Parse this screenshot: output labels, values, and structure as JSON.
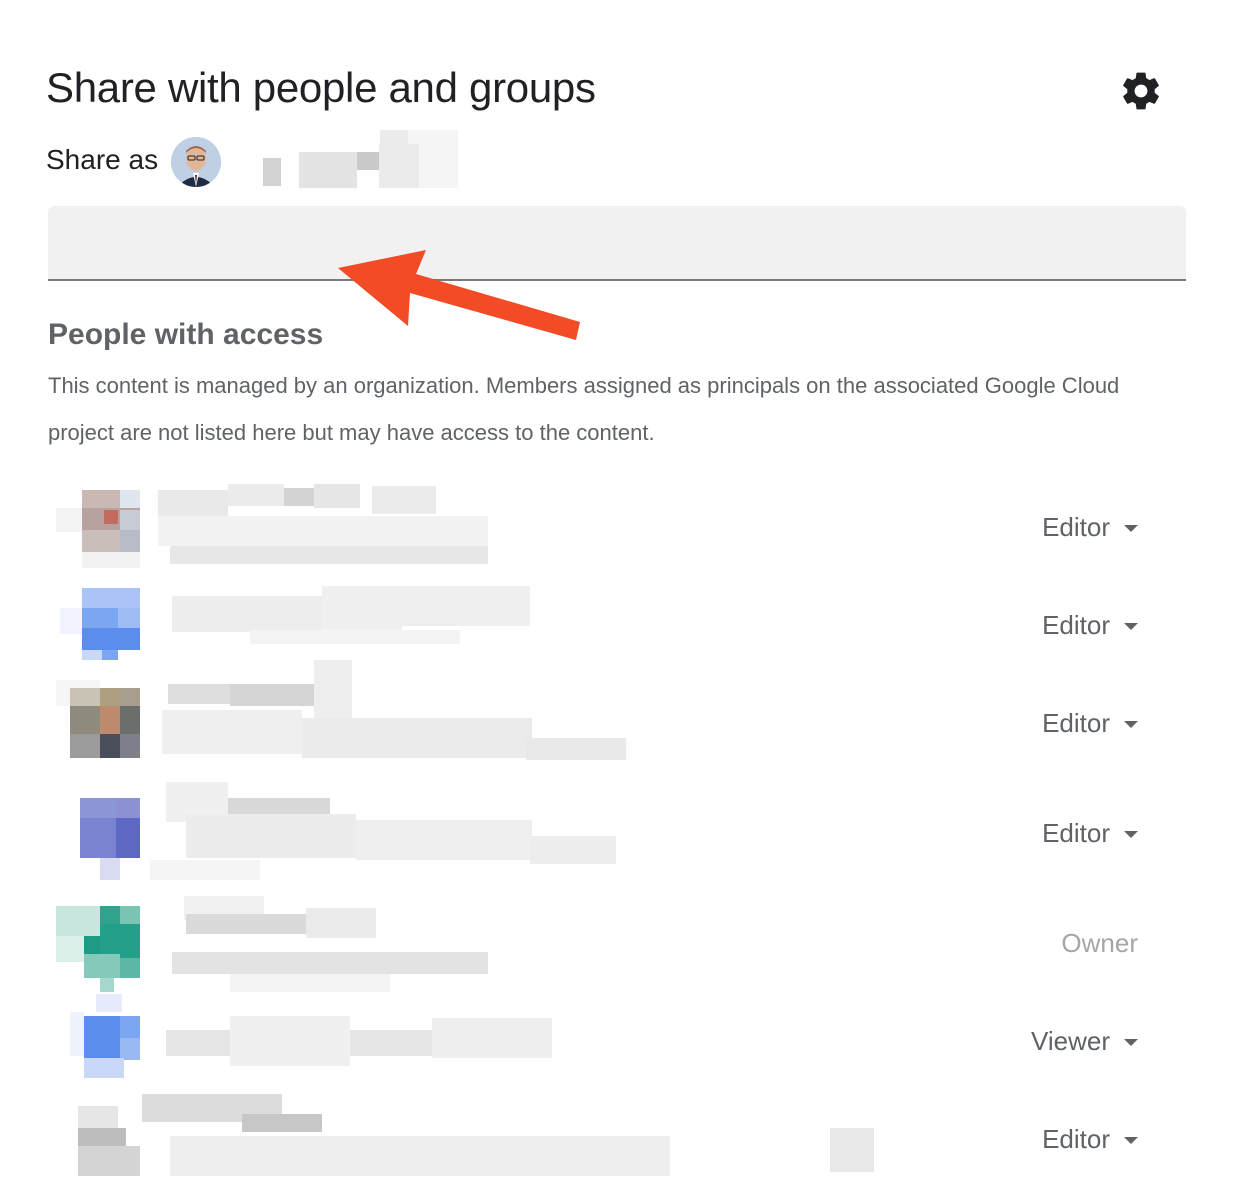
{
  "dialog": {
    "title": "Share with people and groups",
    "settings_icon": "gear-icon",
    "share_as_label": "Share as",
    "search": {
      "value": "",
      "placeholder": ""
    }
  },
  "access": {
    "heading": "People with access",
    "notice": "This content is managed by an organization. Members assigned as principals on the associated Google Cloud project are not listed here but may have access to the content.",
    "people": [
      {
        "role": "Editor",
        "has_dropdown": true,
        "avatar_colors": [
          "#b8a29d",
          "#c46b60",
          "#c8bfbb"
        ]
      },
      {
        "role": "Editor",
        "has_dropdown": true,
        "avatar_colors": [
          "#aac4f7",
          "#5b8def",
          "#7aa6f2"
        ]
      },
      {
        "role": "Editor",
        "has_dropdown": true,
        "avatar_colors": [
          "#a89e8d",
          "#bd8a6d",
          "#4a4e5a"
        ]
      },
      {
        "role": "Editor",
        "has_dropdown": true,
        "avatar_colors": [
          "#8c96d6",
          "#6b76c9",
          "#5d68c2"
        ]
      },
      {
        "role": "Owner",
        "has_dropdown": false,
        "avatar_colors": [
          "#c8e6df",
          "#1f9b85",
          "#7ac4b4"
        ]
      },
      {
        "role": "Viewer",
        "has_dropdown": true,
        "avatar_colors": [
          "#bcd1f7",
          "#5b8def",
          "#7aa6f2"
        ]
      },
      {
        "role": "Editor",
        "has_dropdown": true,
        "avatar_colors": [
          "#cfcfcf",
          "#bdbdbd",
          "#d9d9d9"
        ]
      }
    ]
  },
  "annotation": {
    "arrow_color": "#f24b25"
  }
}
